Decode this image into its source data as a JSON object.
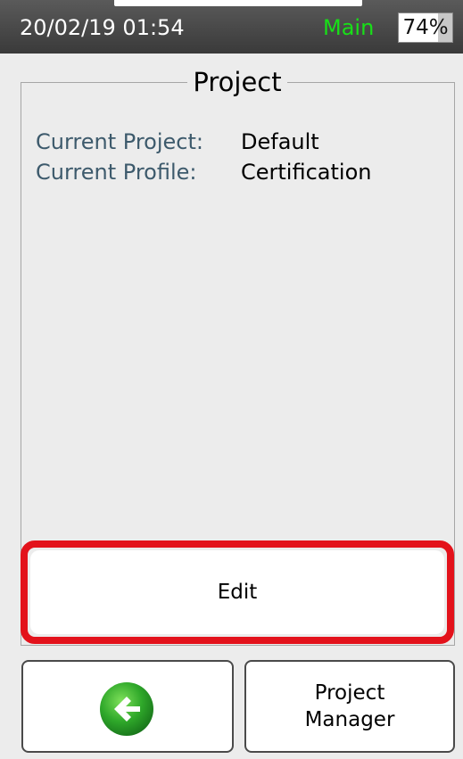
{
  "status_bar": {
    "datetime": "20/02/19 01:54",
    "mode": "Main",
    "battery_text": "74%",
    "battery_level": 0.74,
    "mode_color": "#18e018"
  },
  "project_panel": {
    "title": "Project",
    "rows": [
      {
        "label": "Current Project:",
        "value": "Default"
      },
      {
        "label": "Current Profile:",
        "value": "Certification"
      }
    ]
  },
  "edit_button": {
    "label": "Edit",
    "highlight_color": "#e3121b"
  },
  "bottom_bar": {
    "back_icon": "back-arrow-icon",
    "project_manager_line1": "Project",
    "project_manager_line2": "Manager"
  }
}
